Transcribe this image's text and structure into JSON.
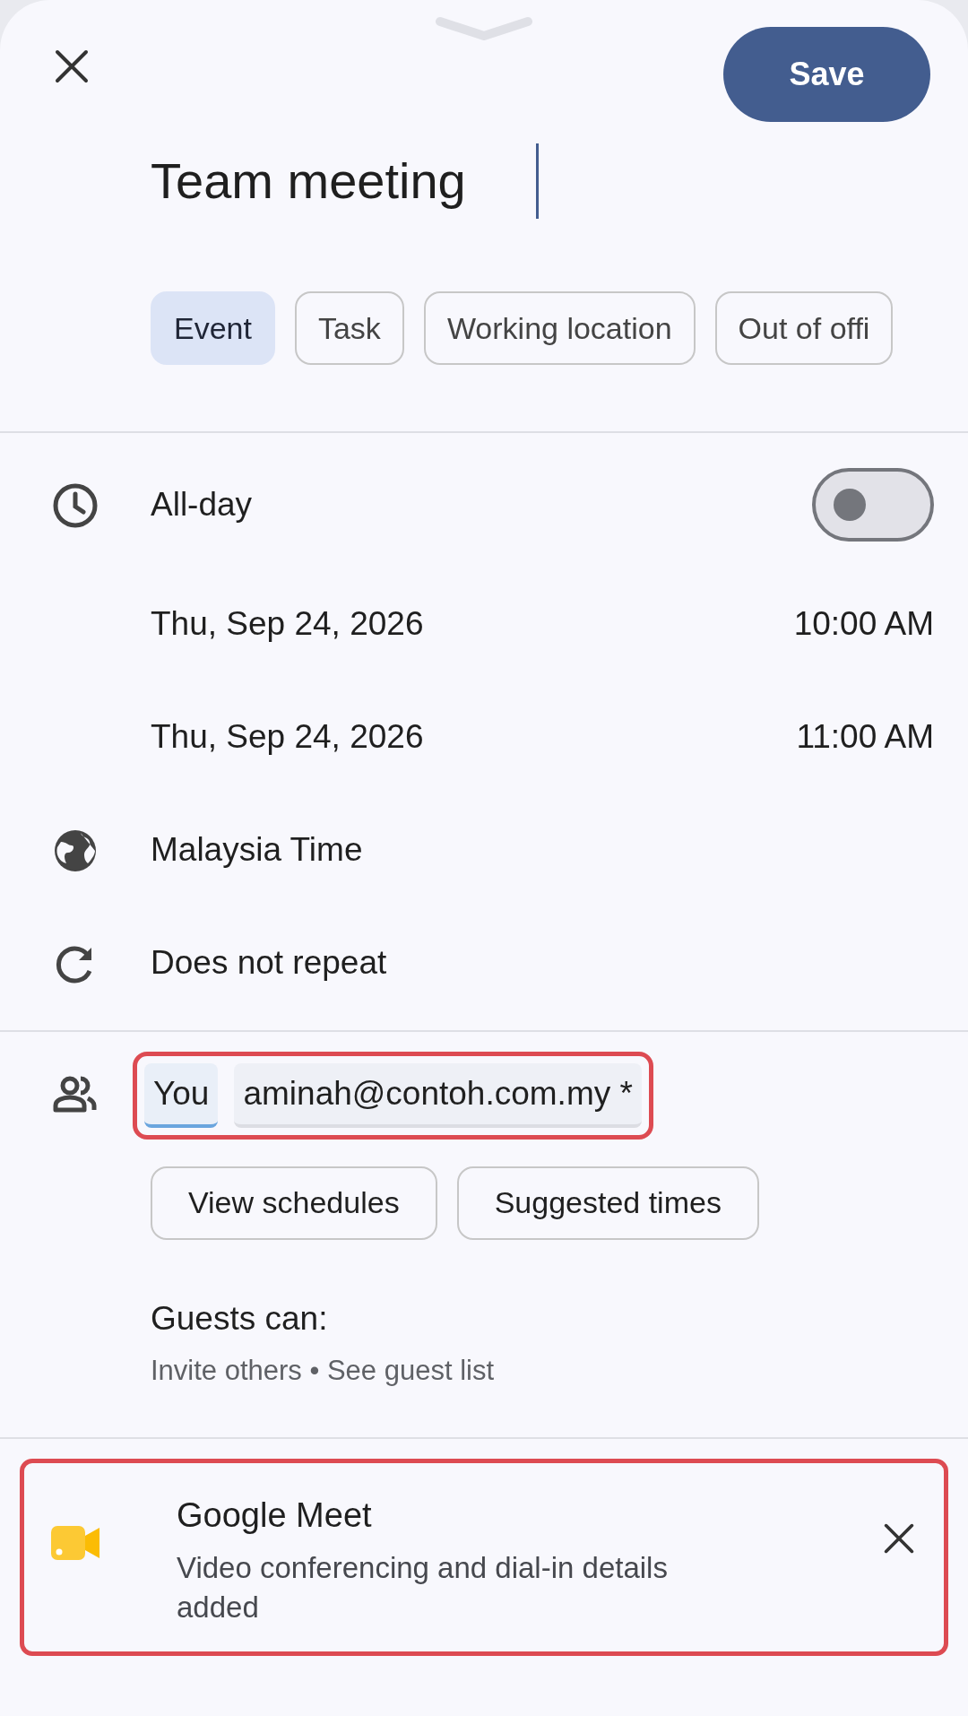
{
  "header": {
    "save_label": "Save"
  },
  "title": {
    "value": "Team meeting"
  },
  "types": [
    {
      "label": "Event",
      "selected": true
    },
    {
      "label": "Task",
      "selected": false
    },
    {
      "label": "Working location",
      "selected": false
    },
    {
      "label": "Out of offi",
      "selected": false
    }
  ],
  "all_day": {
    "label": "All-day",
    "on": false
  },
  "start": {
    "date": "Thu, Sep 24, 2026",
    "time": "10:00 AM"
  },
  "end": {
    "date": "Thu, Sep 24, 2026",
    "time": "11:00 AM"
  },
  "time_zone": "Malaysia Time",
  "repeat": "Does not repeat",
  "guests": {
    "highlighted": true,
    "chips": [
      {
        "label": "You",
        "kind": "self"
      },
      {
        "label": "aminah@contoh.com.my *",
        "kind": "guest"
      }
    ],
    "buttons": [
      "View schedules",
      "Suggested times"
    ],
    "permissions_title": "Guests can:",
    "permissions": "Invite others • See guest list"
  },
  "conference": {
    "highlighted": true,
    "title": "Google Meet",
    "description": "Video conferencing and dial-in details added"
  }
}
